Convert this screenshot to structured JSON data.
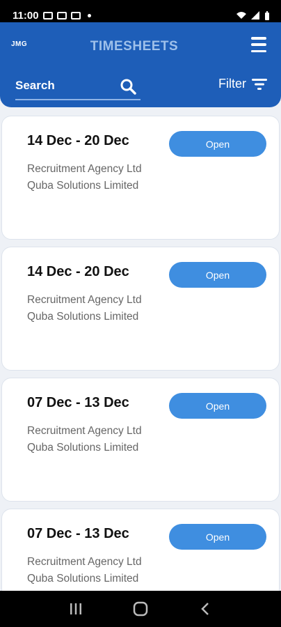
{
  "status_bar": {
    "time": "11:00"
  },
  "header": {
    "logo_text": "JMG",
    "title": "TIMESHEETS",
    "search_placeholder": "Search",
    "filter_label": "Filter"
  },
  "timesheets": [
    {
      "date_range": "14 Dec - 20 Dec",
      "agency": "Recruitment Agency Ltd",
      "client": "Quba Solutions Limited",
      "action_label": "Open"
    },
    {
      "date_range": "14 Dec - 20 Dec",
      "agency": "Recruitment Agency Ltd",
      "client": "Quba Solutions Limited",
      "action_label": "Open"
    },
    {
      "date_range": "07 Dec - 13 Dec",
      "agency": "Recruitment Agency Ltd",
      "client": "Quba Solutions Limited",
      "action_label": "Open"
    },
    {
      "date_range": "07 Dec - 13 Dec",
      "agency": "Recruitment Agency Ltd",
      "client": "Quba Solutions Limited",
      "action_label": "Open"
    }
  ],
  "colors": {
    "header": "#1e5eb8",
    "button": "#3f8ee0",
    "title": "#9ec0ea"
  },
  "icons": {
    "menu": "hamburger-icon",
    "search": "search-icon",
    "filter": "filter-icon"
  }
}
